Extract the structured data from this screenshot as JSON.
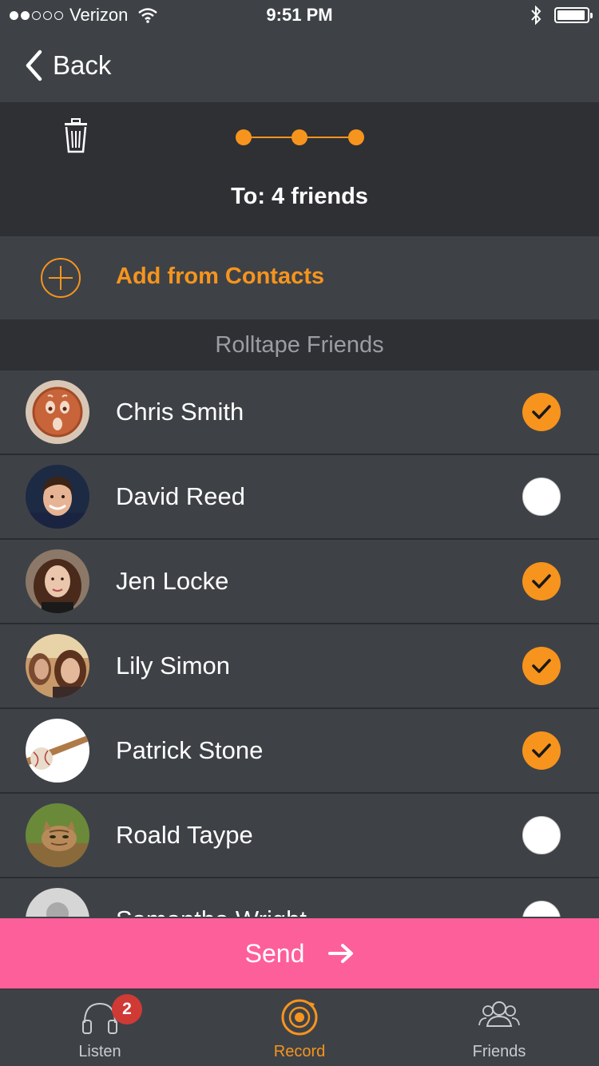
{
  "status_bar": {
    "carrier": "Verizon",
    "time": "9:51 PM",
    "signal_bars_filled": 2,
    "signal_bars_total": 5,
    "battery_fraction": 0.85
  },
  "nav": {
    "back_label": "Back"
  },
  "header": {
    "recipients_text": "To: 4 friends"
  },
  "add_contacts": {
    "label": "Add from Contacts"
  },
  "section": {
    "title": "Rolltape Friends"
  },
  "friends": [
    {
      "name": "Chris Smith",
      "selected": true
    },
    {
      "name": "David Reed",
      "selected": false
    },
    {
      "name": "Jen Locke",
      "selected": true
    },
    {
      "name": "Lily Simon",
      "selected": true
    },
    {
      "name": "Patrick Stone",
      "selected": true
    },
    {
      "name": "Roald Taype",
      "selected": false
    },
    {
      "name": "Samantha Wright",
      "selected": false
    }
  ],
  "send": {
    "label": "Send"
  },
  "tabs": [
    {
      "label": "Listen",
      "badge": "2",
      "icon": "headphones-icon"
    },
    {
      "label": "Record",
      "icon": "record-icon",
      "active": true
    },
    {
      "label": "Friends",
      "icon": "friends-icon"
    }
  ],
  "colors": {
    "accent": "#f7941d",
    "send": "#fd5f9b",
    "background": "#3e4247",
    "dark": "#2e3034"
  }
}
